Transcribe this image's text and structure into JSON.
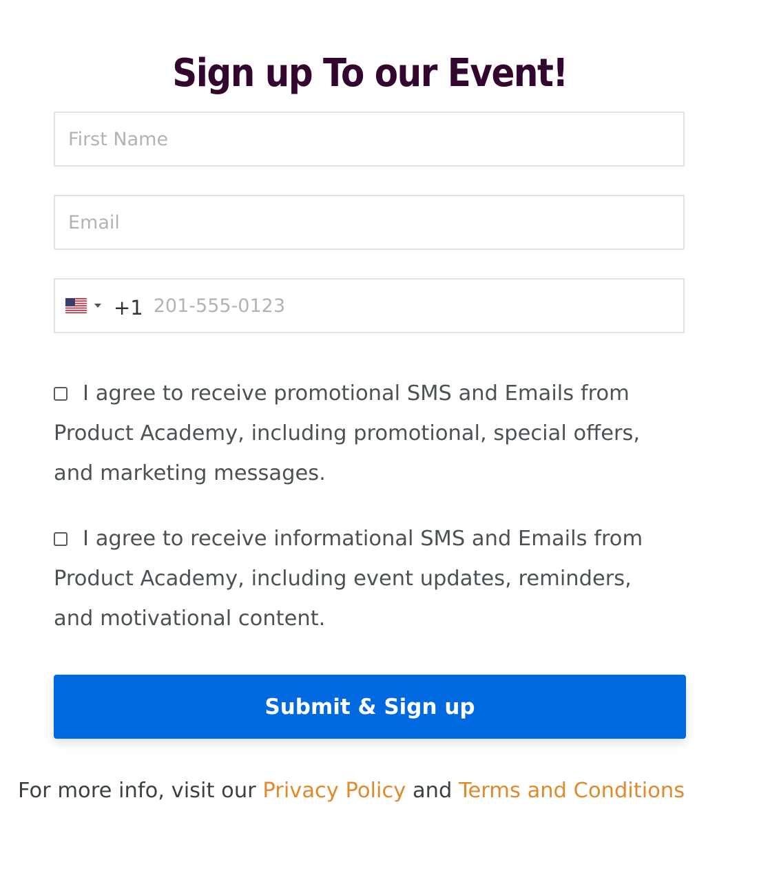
{
  "form": {
    "title": "Sign up To our Event!",
    "first_name": {
      "placeholder": "First Name",
      "value": ""
    },
    "email": {
      "placeholder": "Email",
      "value": ""
    },
    "phone": {
      "country_icon": "us-flag-icon",
      "dial_code": "+1",
      "placeholder": "201-555-0123",
      "value": ""
    },
    "consents": [
      {
        "checked": false,
        "label": "I agree to receive promotional SMS and Emails from Product Academy, including promotional, special offers, and marketing messages."
      },
      {
        "checked": false,
        "label": "I agree to receive informational SMS and Emails from Product Academy, including event updates, reminders, and motivational content."
      }
    ],
    "submit_label": "Submit & Sign up"
  },
  "footer": {
    "prefix": "For more info, visit our ",
    "privacy_link": "Privacy Policy",
    "connector": " and ",
    "terms_link": "Terms and Conditions"
  },
  "colors": {
    "title": "#33062f",
    "button": "#0069e0",
    "link": "#e08a2a",
    "body_text": "#4b5255"
  }
}
